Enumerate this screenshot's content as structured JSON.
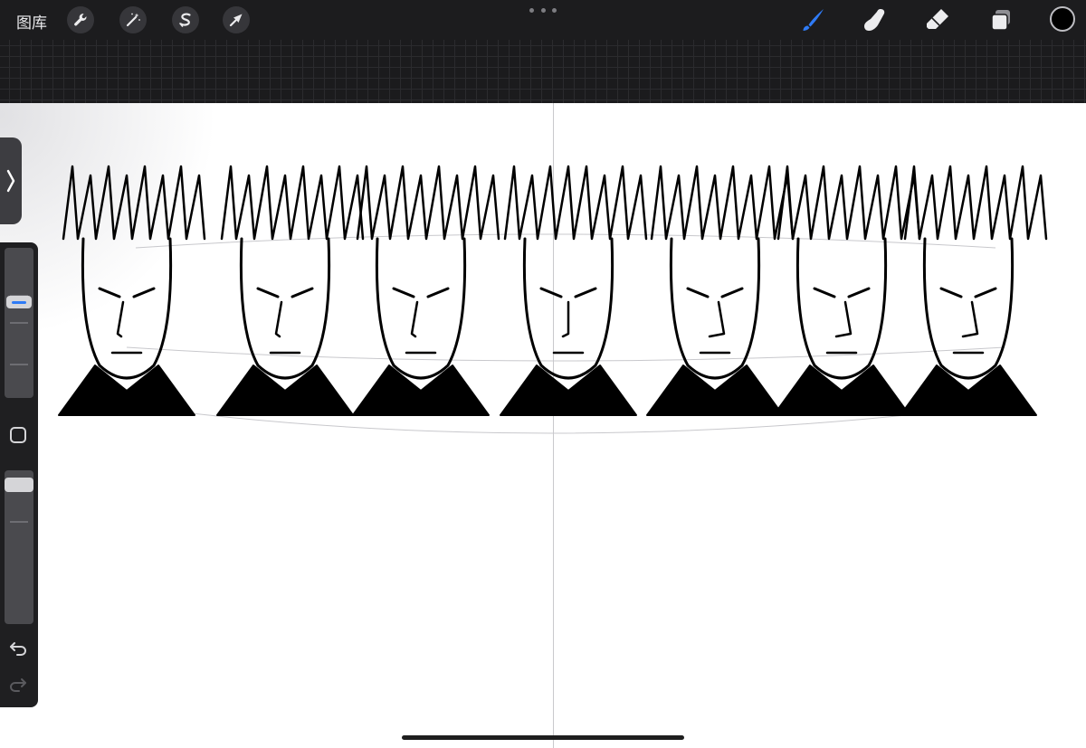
{
  "app": {
    "gallery_label": "图库"
  },
  "toolbar": {
    "left_tools": [
      {
        "name": "actions",
        "icon": "wrench-icon"
      },
      {
        "name": "adjustments",
        "icon": "magic-wand-icon"
      },
      {
        "name": "selection",
        "icon": "selection-s-icon"
      },
      {
        "name": "transform",
        "icon": "arrow-cursor-icon"
      }
    ],
    "right_tools": [
      {
        "name": "brush",
        "icon": "brush-icon",
        "active": true
      },
      {
        "name": "smudge",
        "icon": "smudge-finger-icon"
      },
      {
        "name": "eraser",
        "icon": "eraser-icon"
      },
      {
        "name": "layers",
        "icon": "layers-icon"
      }
    ],
    "more_icon": "more-dots-icon",
    "current_color": "#000000",
    "accent_color": "#2f7bf6"
  },
  "sidebar": {
    "toggle_icon": "chevron-right-icon",
    "brush_size_level": 0.65,
    "opacity_level": 0.95,
    "modify_icon": "square-modify-icon",
    "undo_icon": "undo-icon",
    "redo_icon": "redo-icon"
  },
  "canvas": {
    "background": "#ffffff",
    "artwork": "character-turnaround-heads"
  }
}
